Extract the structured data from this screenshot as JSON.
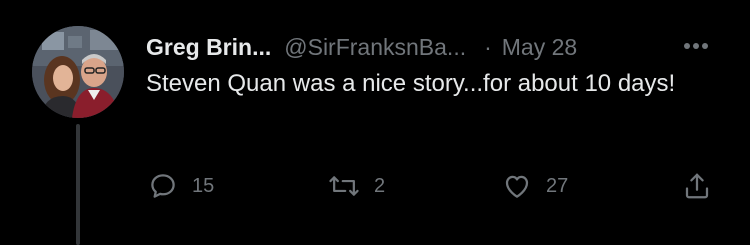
{
  "tweet": {
    "display_name": "Greg Brin...",
    "handle": "@SirFranksnBa...",
    "separator": "·",
    "date": "May 28",
    "text": "Steven Quan was a nice story...for about 10 days!",
    "more_icon": "more-horizontal-icon",
    "avatar": "avatar-photo"
  },
  "actions": {
    "reply": {
      "icon": "reply-icon",
      "count": "15"
    },
    "retweet": {
      "icon": "retweet-icon",
      "count": "2"
    },
    "like": {
      "icon": "heart-icon",
      "count": "27"
    },
    "share": {
      "icon": "share-icon"
    }
  },
  "colors": {
    "background": "#000000",
    "text_primary": "#e7e9ea",
    "text_secondary": "#71767b",
    "thread_line": "#333639"
  }
}
